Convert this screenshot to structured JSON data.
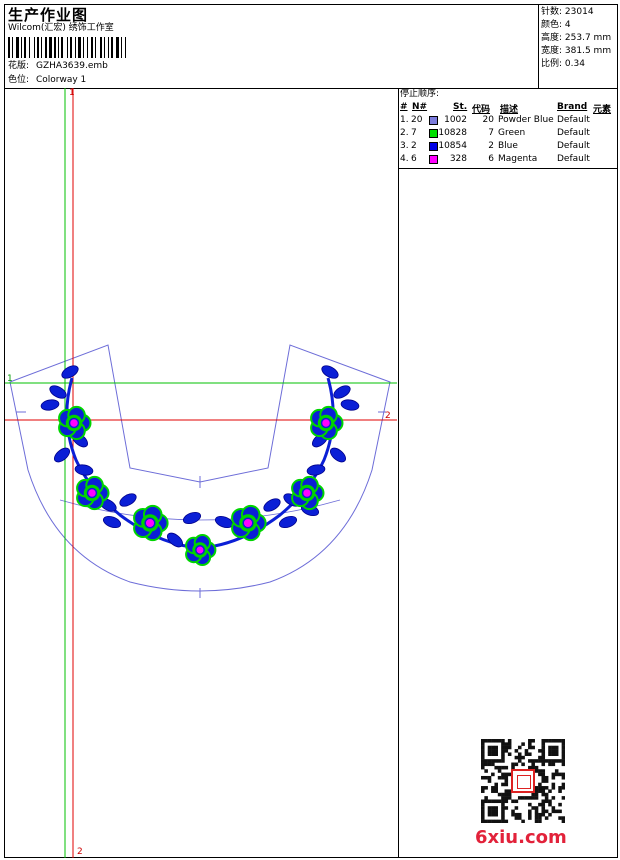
{
  "header": {
    "title": "生产作业图",
    "company": "Wilcom(汇宏) 绣饰工作室",
    "design_label": "花版:",
    "design_value": "GZHA3639.emb",
    "colorway_label": "色位:",
    "colorway_value": "Colorway 1"
  },
  "info": [
    {
      "label": "针数:",
      "value": "23014"
    },
    {
      "label": "颜色:",
      "value": "4"
    },
    {
      "label": "高度:",
      "value": "253.7 mm"
    },
    {
      "label": "宽度:",
      "value": "381.5 mm"
    },
    {
      "label": "比例:",
      "value": "0.34"
    }
  ],
  "stop_sequence": {
    "title": "停止顺序:",
    "headers": {
      "num": "#",
      "n": "N#",
      "st": "St.",
      "code": "代码",
      "desc": "描述",
      "brand": "Brand",
      "elem": "元素"
    },
    "rows": [
      {
        "num": "1.",
        "n": "20",
        "color": "#7b7bdc",
        "st": "1002",
        "code": "20",
        "desc": "Powder Blue",
        "brand": "Default"
      },
      {
        "num": "2.",
        "n": "7",
        "color": "#00e000",
        "st": "10828",
        "code": "7",
        "desc": "Green",
        "brand": "Default"
      },
      {
        "num": "3.",
        "n": "2",
        "color": "#0000e6",
        "st": "10854",
        "code": "2",
        "desc": "Blue",
        "brand": "Default"
      },
      {
        "num": "4.",
        "n": "6",
        "color": "#ff00ff",
        "st": "328",
        "code": "6",
        "desc": "Magenta",
        "brand": "Default"
      }
    ]
  },
  "guides": {
    "v_label_top": "1",
    "v_label_bottom": "2",
    "h_label_left": "1",
    "h_label_right": "2"
  },
  "watermark": {
    "site": "6xiu.com"
  }
}
